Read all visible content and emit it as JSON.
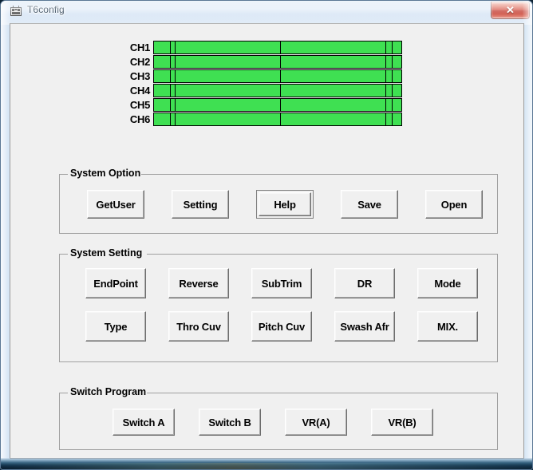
{
  "window": {
    "title": "T6config",
    "icon": "transmitter-icon",
    "close_label": "✕"
  },
  "channels": {
    "rows": [
      {
        "label": "CH1",
        "value_pct": 100
      },
      {
        "label": "CH2",
        "value_pct": 100
      },
      {
        "label": "CH3",
        "value_pct": 100
      },
      {
        "label": "CH4",
        "value_pct": 100
      },
      {
        "label": "CH5",
        "value_pct": 100
      },
      {
        "label": "CH6",
        "value_pct": 100
      }
    ],
    "bar_color": "#3fe052",
    "divider_positions_pct": [
      6.5,
      8.5,
      51.0,
      93.5,
      96.0
    ]
  },
  "groups": [
    {
      "title": "System Option",
      "buttons": [
        {
          "label": "GetUser",
          "default": false
        },
        {
          "label": "Setting",
          "default": false
        },
        {
          "label": "Help",
          "default": true
        },
        {
          "label": "Save",
          "default": false
        },
        {
          "label": "Open",
          "default": false
        }
      ]
    },
    {
      "title": "System Setting",
      "buttons": [
        {
          "label": "EndPoint",
          "default": false
        },
        {
          "label": "Reverse",
          "default": false
        },
        {
          "label": "SubTrim",
          "default": false
        },
        {
          "label": "DR",
          "default": false
        },
        {
          "label": "Mode",
          "default": false
        },
        {
          "label": "Type",
          "default": false
        },
        {
          "label": "Thro Cuv",
          "default": false
        },
        {
          "label": "Pitch Cuv",
          "default": false
        },
        {
          "label": "Swash Afr",
          "default": false
        },
        {
          "label": "MIX.",
          "default": false
        }
      ]
    },
    {
      "title": "Switch Program",
      "buttons": [
        {
          "label": "Switch A",
          "default": false
        },
        {
          "label": "Switch B",
          "default": false
        },
        {
          "label": "VR(A)",
          "default": false
        },
        {
          "label": "VR(B)",
          "default": false
        }
      ]
    }
  ],
  "colors": {
    "titlebar_accent": "#cddff2",
    "close_button": "#d1483a",
    "bar_green": "#3fe052",
    "client_bg": "#f0f0f0"
  }
}
